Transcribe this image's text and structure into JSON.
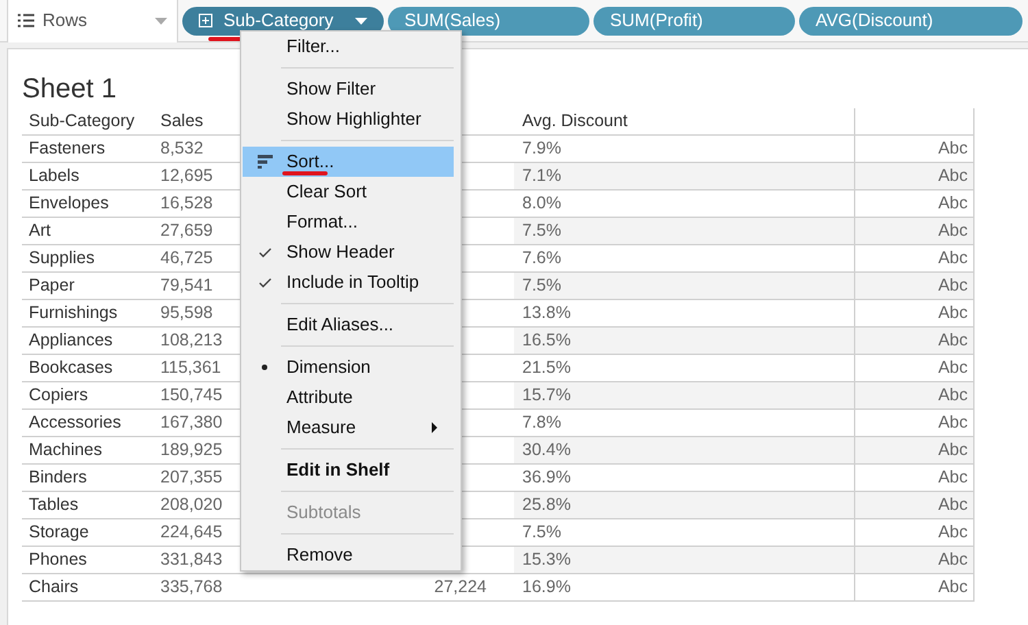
{
  "shelf": {
    "label": "Rows"
  },
  "pills": [
    {
      "label": "Sub-Category",
      "kind": "dimension",
      "selected": true
    },
    {
      "label": "SUM(Sales)",
      "kind": "measure",
      "selected": false
    },
    {
      "label": "SUM(Profit)",
      "kind": "measure",
      "selected": false
    },
    {
      "label": "AVG(Discount)",
      "kind": "measure",
      "selected": false
    }
  ],
  "sheet": {
    "title": "Sheet 1"
  },
  "table": {
    "columns": [
      "Sub-Category",
      "Sales",
      "",
      "Avg. Discount",
      ""
    ],
    "rows": [
      {
        "sub_category": "Fasteners",
        "sales": "8,532",
        "discount": "7.9%",
        "mark": "Abc"
      },
      {
        "sub_category": "Labels",
        "sales": "12,695",
        "discount": "7.1%",
        "mark": "Abc"
      },
      {
        "sub_category": "Envelopes",
        "sales": "16,528",
        "discount": "8.0%",
        "mark": "Abc"
      },
      {
        "sub_category": "Art",
        "sales": "27,659",
        "discount": "7.5%",
        "mark": "Abc"
      },
      {
        "sub_category": "Supplies",
        "sales": "46,725",
        "discount": "7.6%",
        "mark": "Abc"
      },
      {
        "sub_category": "Paper",
        "sales": "79,541",
        "discount": "7.5%",
        "mark": "Abc"
      },
      {
        "sub_category": "Furnishings",
        "sales": "95,598",
        "discount": "13.8%",
        "mark": "Abc"
      },
      {
        "sub_category": "Appliances",
        "sales": "108,213",
        "discount": "16.5%",
        "mark": "Abc"
      },
      {
        "sub_category": "Bookcases",
        "sales": "115,361",
        "discount": "21.5%",
        "mark": "Abc"
      },
      {
        "sub_category": "Copiers",
        "sales": "150,745",
        "discount": "15.7%",
        "mark": "Abc"
      },
      {
        "sub_category": "Accessories",
        "sales": "167,380",
        "discount": "7.8%",
        "mark": "Abc"
      },
      {
        "sub_category": "Machines",
        "sales": "189,925",
        "discount": "30.4%",
        "mark": "Abc"
      },
      {
        "sub_category": "Binders",
        "sales": "207,355",
        "discount": "36.9%",
        "mark": "Abc"
      },
      {
        "sub_category": "Tables",
        "sales": "208,020",
        "discount": "25.8%",
        "mark": "Abc"
      },
      {
        "sub_category": "Storage",
        "sales": "224,645",
        "discount": "7.5%",
        "mark": "Abc"
      },
      {
        "sub_category": "Phones",
        "sales": "331,843",
        "discount": "15.3%",
        "mark": "Abc"
      },
      {
        "sub_category": "Chairs",
        "sales": "335,768",
        "profit": "27,224",
        "discount": "16.9%",
        "mark": "Abc"
      }
    ]
  },
  "context_menu": {
    "items": [
      {
        "kind": "item",
        "label": "Filter..."
      },
      {
        "kind": "separator"
      },
      {
        "kind": "item",
        "label": "Show Filter"
      },
      {
        "kind": "item",
        "label": "Show Highlighter"
      },
      {
        "kind": "separator"
      },
      {
        "kind": "sort",
        "label": "Sort...",
        "selected": true
      },
      {
        "kind": "item",
        "label": "Clear Sort"
      },
      {
        "kind": "item",
        "label": "Format..."
      },
      {
        "kind": "item",
        "label": "Show Header",
        "checked": true
      },
      {
        "kind": "item",
        "label": "Include in Tooltip",
        "checked": true
      },
      {
        "kind": "separator"
      },
      {
        "kind": "item",
        "label": "Edit Aliases..."
      },
      {
        "kind": "separator"
      },
      {
        "kind": "item",
        "label": "Dimension",
        "bullet": true
      },
      {
        "kind": "item",
        "label": "Attribute"
      },
      {
        "kind": "item",
        "label": "Measure",
        "submenu": true
      },
      {
        "kind": "separator"
      },
      {
        "kind": "item",
        "label": "Edit in Shelf",
        "bold": true
      },
      {
        "kind": "separator"
      },
      {
        "kind": "item",
        "label": "Subtotals",
        "disabled": true
      },
      {
        "kind": "separator"
      },
      {
        "kind": "item",
        "label": "Remove"
      }
    ]
  }
}
